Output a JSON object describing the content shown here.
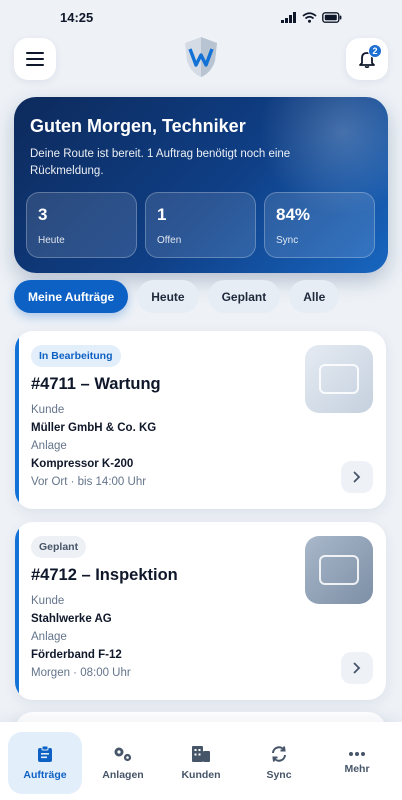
{
  "status_bar": {
    "time": "14:25"
  },
  "header": {
    "notification_count": "2"
  },
  "hero": {
    "title": "Guten Morgen, Techniker",
    "subtitle": "Deine Route ist bereit. 1 Auftrag benötigt noch eine Rückmeldung.",
    "stats": [
      {
        "value": "3",
        "label": "Heute"
      },
      {
        "value": "1",
        "label": "Offen"
      },
      {
        "value": "84%",
        "label": "Sync"
      }
    ]
  },
  "filters": [
    {
      "label": "Meine Aufträge",
      "active": true
    },
    {
      "label": "Heute",
      "active": false
    },
    {
      "label": "Geplant",
      "active": false
    },
    {
      "label": "Alle",
      "active": false
    }
  ],
  "orders": [
    {
      "status": "In Bearbeitung",
      "title": "#4711 – Wartung",
      "customer_label": "Kunde",
      "customer": "Müller GmbH & Co. KG",
      "asset_label": "Anlage",
      "asset": "Kompressor K-200",
      "footer": "Vor Ort · bis 14:00 Uhr"
    },
    {
      "status": "Geplant",
      "title": "#4712 – Inspektion",
      "customer_label": "Kunde",
      "customer": "Stahlwerke AG",
      "asset_label": "Anlage",
      "asset": "Förderband F-12",
      "footer": "Morgen · 08:00 Uhr"
    }
  ],
  "tabs": [
    {
      "label": "Aufträge",
      "icon": "clipboard-icon",
      "active": true
    },
    {
      "label": "Anlagen",
      "icon": "gears-icon",
      "active": false
    },
    {
      "label": "Kunden",
      "icon": "building-icon",
      "active": false
    },
    {
      "label": "Sync",
      "icon": "sync-icon",
      "active": false
    },
    {
      "label": "Mehr",
      "icon": "more-icon",
      "active": false
    }
  ],
  "colors": {
    "primary": "#0e61c4",
    "hero_dark": "#0d2a5c",
    "accent": "#1372d6"
  }
}
